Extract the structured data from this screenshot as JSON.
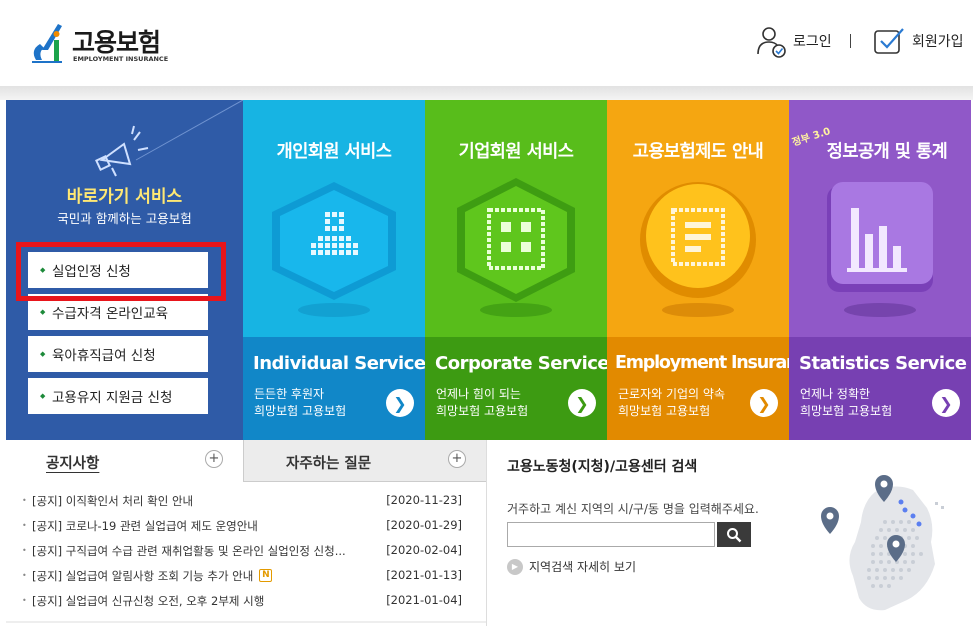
{
  "header": {
    "logo_text": "고용보험",
    "logo_sub": "EMPLOYMENT INSURANCE",
    "login_label": "로그인",
    "divider": "|",
    "join_label": "회원가입"
  },
  "quick": {
    "title": "바로가기 서비스",
    "subtitle": "국민과 함께하는 고용보험",
    "items": [
      {
        "label": "실업인정 신청"
      },
      {
        "label": "수급자격 온라인교육"
      },
      {
        "label": "육아휴직급여 신청"
      },
      {
        "label": "고용유지 지원금 신청"
      }
    ]
  },
  "tiles": [
    {
      "title": "개인회원 서비스",
      "en": "Individual Service",
      "desc1": "든든한 후원자",
      "desc2": "희망보험 고용보험",
      "arrow": "❯",
      "color": "#17b4e3",
      "bottom": "#1187c8",
      "arrow_color": "#1187c8"
    },
    {
      "title": "기업회원 서비스",
      "en": "Corporate Service",
      "desc1": "언제나 힘이 되는",
      "desc2": "희망보험 고용보험",
      "arrow": "❯",
      "color": "#58bd1b",
      "bottom": "#3d9b12",
      "arrow_color": "#3d9b12"
    },
    {
      "title": "고용보험제도 안내",
      "en": "Employment Insurance",
      "desc1": "근로자와 기업의 약속",
      "desc2": "희망보험 고용보험",
      "arrow": "❯",
      "color": "#f5a611",
      "bottom": "#e28a00",
      "arrow_color": "#e28a00"
    },
    {
      "title": "정보공개 및 통계",
      "title_prefix": "정부 3.0",
      "en": "Statistics Service",
      "desc1": "언제나 정확한",
      "desc2": "희망보험 고용보험",
      "arrow": "❯",
      "color": "#9058c8",
      "bottom": "#7740b2",
      "arrow_color": "#7740b2"
    }
  ],
  "notice": {
    "tab1_label": "공지사항",
    "tab2_label": "자주하는 질문",
    "plus": "+",
    "items": [
      {
        "text": "[공지] 이직확인서 처리 확인 안내",
        "date": "[2020-11-23]",
        "new": false
      },
      {
        "text": "[공지] 코로나-19 관련 실업급여 제도 운영안내",
        "date": "[2020-01-29]",
        "new": false
      },
      {
        "text": "[공지] 구직급여 수급 관련 재취업활동 및 온라인 실업인정 신청...",
        "date": "[2020-02-04]",
        "new": false
      },
      {
        "text": "[공지] 실업급여 알림사항 조회 기능 추가 안내",
        "date": "[2021-01-13]",
        "new": true,
        "badge": "N"
      },
      {
        "text": "[공지] 실업급여 신규신청 오전, 오후 2부제 시행",
        "date": "[2021-01-04]",
        "new": false
      }
    ]
  },
  "search": {
    "title": "고용노동청(지청)/고용센터 검색",
    "desc": "거주하고 계신 지역의 시/구/동 명을 입력해주세요.",
    "placeholder": "",
    "detail_label": "지역검색 자세히 보기"
  }
}
